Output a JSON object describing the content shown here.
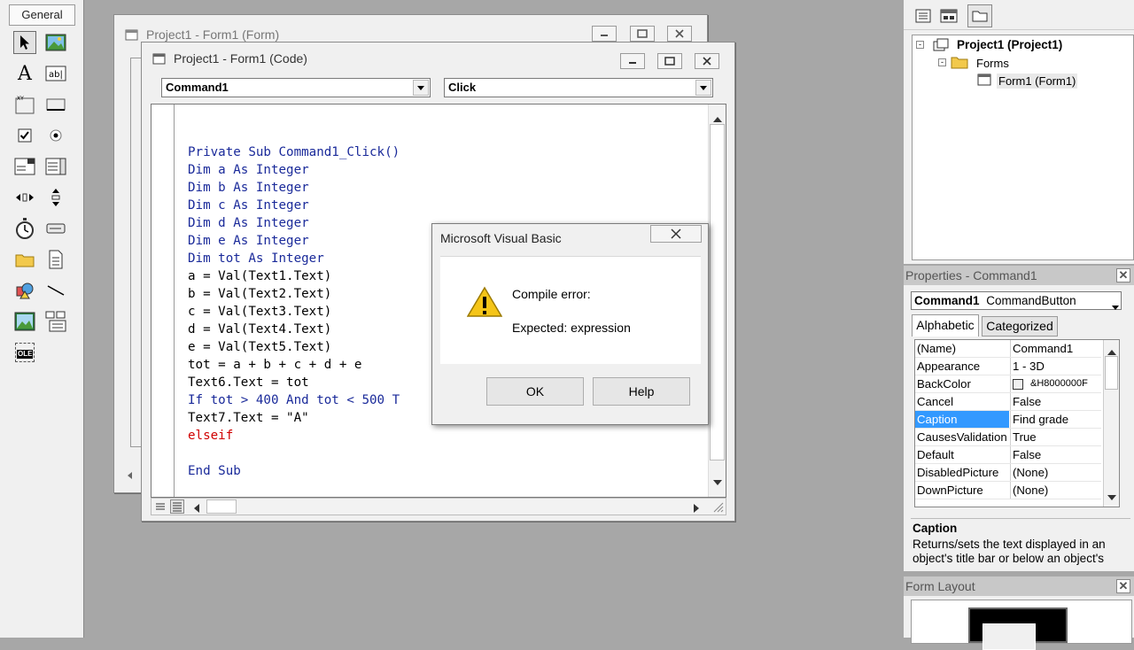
{
  "toolbox": {
    "tab_label": "General",
    "tools": [
      "pointer-icon",
      "picturebox-icon",
      "label-icon",
      "textbox-icon",
      "frame-icon",
      "commandbutton-icon",
      "checkbox-icon",
      "optionbutton-icon",
      "combobox-icon",
      "listbox-icon",
      "hscrollbar-icon",
      "vscrollbar-icon",
      "timer-icon",
      "drivelistbox-icon",
      "dirlistbox-icon",
      "filelistbox-icon",
      "shape-icon",
      "line-icon",
      "image-icon",
      "data-icon",
      "ole-icon"
    ],
    "ole_label": "OLE"
  },
  "form_window": {
    "title": "Project1 - Form1 (Form)"
  },
  "code_window": {
    "title": "Project1 - Form1 (Code)",
    "object_combo": "Command1",
    "procedure_combo": "Click",
    "lines": [
      {
        "code": "Private Sub Command1_Click()",
        "style": "kw"
      },
      {
        "code": "Dim a As Integer",
        "style": "kw"
      },
      {
        "code": "Dim b As Integer",
        "style": "kw"
      },
      {
        "code": "Dim c As Integer",
        "style": "kw"
      },
      {
        "code": "Dim d As Integer",
        "style": "kw"
      },
      {
        "code": "Dim e As Integer",
        "style": "kw"
      },
      {
        "code": "Dim tot As Integer",
        "style": "kw"
      },
      {
        "code": "a = Val(Text1.Text)",
        "style": "plain"
      },
      {
        "code": "b = Val(Text2.Text)",
        "style": "plain"
      },
      {
        "code": "c = Val(Text3.Text)",
        "style": "plain"
      },
      {
        "code": "d = Val(Text4.Text)",
        "style": "plain"
      },
      {
        "code": "e = Val(Text5.Text)",
        "style": "plain"
      },
      {
        "code": "tot = a + b + c + d + e",
        "style": "plain"
      },
      {
        "code": "Text6.Text = tot",
        "style": "plain"
      },
      {
        "code": "If tot > 400 And tot < 500 T",
        "style": "kw"
      },
      {
        "code": "Text7.Text = \"A\"",
        "style": "plain"
      },
      {
        "code": "elseif",
        "style": "err"
      },
      {
        "code": "",
        "style": "plain"
      },
      {
        "code": "End Sub",
        "style": "kw"
      }
    ]
  },
  "dialog": {
    "title": "Microsoft Visual Basic",
    "message_line1": "Compile error:",
    "message_line2": "Expected: expression",
    "ok_label": "OK",
    "help_label": "Help"
  },
  "project_explorer": {
    "root": "Project1 (Project1)",
    "folder": "Forms",
    "item": "Form1 (Form1)"
  },
  "properties": {
    "header": "Properties - Command1",
    "object_name": "Command1",
    "object_type": "CommandButton",
    "tabs": [
      "Alphabetic",
      "Categorized"
    ],
    "rows": [
      {
        "name": "(Name)",
        "value": "Command1"
      },
      {
        "name": "Appearance",
        "value": "1 - 3D"
      },
      {
        "name": "BackColor",
        "value": "&H8000000F"
      },
      {
        "name": "Cancel",
        "value": "False"
      },
      {
        "name": "Caption",
        "value": "Find grade"
      },
      {
        "name": "CausesValidation",
        "value": "True"
      },
      {
        "name": "Default",
        "value": "False"
      },
      {
        "name": "DisabledPicture",
        "value": "(None)"
      },
      {
        "name": "DownPicture",
        "value": "(None)"
      }
    ],
    "selected_row": "Caption",
    "description_title": "Caption",
    "description_text": "Returns/sets the text displayed in an object's title bar or below an object's"
  },
  "form_layout": {
    "header": "Form Layout"
  },
  "colors": {
    "keyword": "#1a2a9a",
    "error": "#d00000",
    "selection": "#3399ff",
    "mdi_background": "#a7a7a7"
  }
}
